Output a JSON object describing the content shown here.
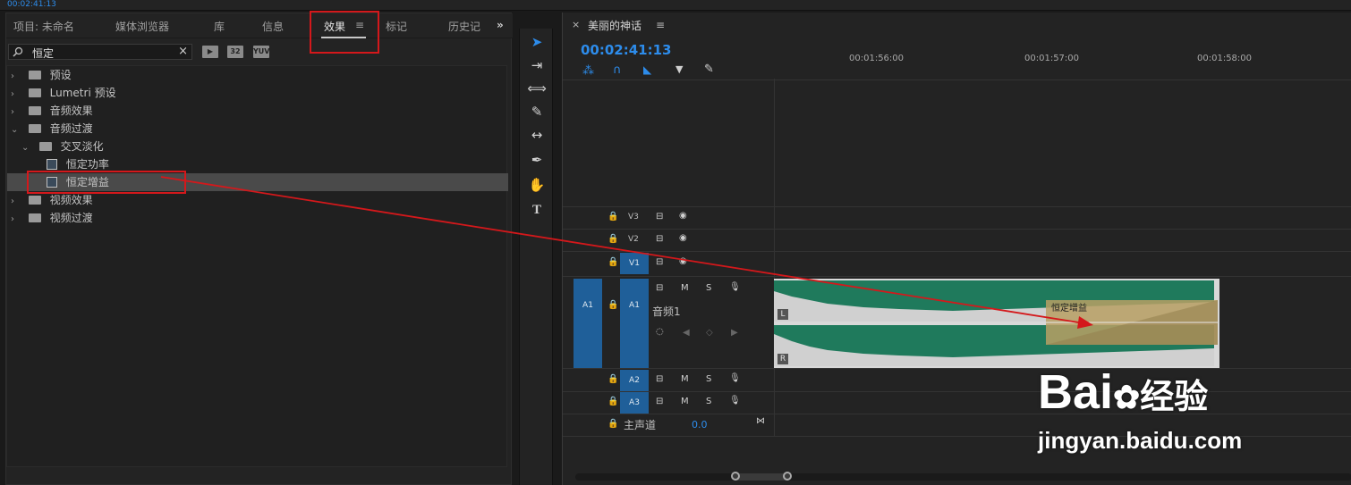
{
  "top": {
    "timecode": "00:02:41:13"
  },
  "effects_panel": {
    "tabs": [
      "项目: 未命名",
      "媒体浏览器",
      "库",
      "信息",
      "效果",
      "标记",
      "历史记"
    ],
    "menu_icon": "≡",
    "overflow_icon": "»",
    "search_value": "恒定",
    "clear_icon": "×",
    "toolbar_badges": [
      "32",
      "YUV"
    ],
    "tree": [
      {
        "label": "预设",
        "level": 0,
        "expanded": false,
        "kind": "folder"
      },
      {
        "label": "Lumetri 预设",
        "level": 0,
        "expanded": false,
        "kind": "folder"
      },
      {
        "label": "音频效果",
        "level": 0,
        "expanded": false,
        "kind": "folder"
      },
      {
        "label": "音频过渡",
        "level": 0,
        "expanded": true,
        "kind": "folder"
      },
      {
        "label": "交叉淡化",
        "level": 1,
        "expanded": true,
        "kind": "folder"
      },
      {
        "label": "恒定功率",
        "level": 2,
        "kind": "effect"
      },
      {
        "label": "恒定增益",
        "level": 2,
        "kind": "effect",
        "selected": true
      },
      {
        "label": "视频效果",
        "level": 0,
        "expanded": false,
        "kind": "folder"
      },
      {
        "label": "视频过渡",
        "level": 0,
        "expanded": false,
        "kind": "folder"
      }
    ]
  },
  "timeline": {
    "close_icon": "×",
    "sequence_name": "美丽的神话",
    "menu_icon": "≡",
    "timecode": "00:02:41:13",
    "ruler_labels": [
      "00:01:56:00",
      "00:01:57:00",
      "00:01:58:00"
    ],
    "video_tracks": [
      "V3",
      "V2",
      "V1"
    ],
    "audio_track_name": "音频1",
    "source_patch": "A1",
    "a_tracks": [
      "A1",
      "A2",
      "A3"
    ],
    "mute": "M",
    "solo": "S",
    "master_label": "主声道",
    "master_value": "0.0",
    "channel_left": "L",
    "channel_right": "R",
    "transition_label": "恒定增益"
  },
  "watermark": {
    "brand": "Bai",
    "brand2": "经验",
    "url": "jingyan.baidu.com"
  },
  "colors": {
    "accent": "#2d8ceb",
    "annotation": "#d4181b",
    "waveform": "#1f7a5c",
    "transition": "#b8a064"
  }
}
